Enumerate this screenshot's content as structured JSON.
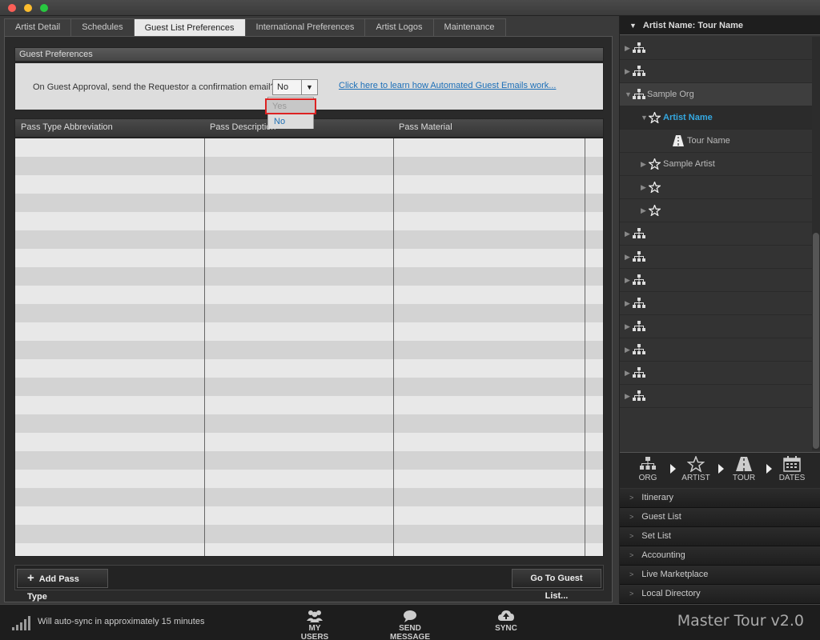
{
  "window": {
    "title": ""
  },
  "tabs": [
    {
      "label": "Artist Detail"
    },
    {
      "label": "Schedules"
    },
    {
      "label": "Guest List Preferences"
    },
    {
      "label": "International Preferences"
    },
    {
      "label": "Artist Logos"
    },
    {
      "label": "Maintenance"
    }
  ],
  "active_tab": "Guest List Preferences",
  "guest_prefs": {
    "header": "Guest Preferences",
    "question": "On Guest Approval, send the Requestor a confirmation email?",
    "selected": "No",
    "link": "Click here to learn how Automated Guest Emails work...",
    "options": [
      "Yes",
      "No"
    ]
  },
  "table": {
    "columns": [
      "Pass Type Abbreviation",
      "Pass Description",
      "Pass Material"
    ],
    "rows": []
  },
  "buttons": {
    "add": "Add Pass Type",
    "go": "Go To Guest List..."
  },
  "right_panel": {
    "header": "Artist Name: Tour Name",
    "tree": [
      {
        "type": "org",
        "label": ""
      },
      {
        "type": "org",
        "label": ""
      },
      {
        "type": "org",
        "label": "Sample Org",
        "expanded": true
      },
      {
        "type": "artist",
        "label": "Artist Name",
        "expanded": true,
        "selected": true
      },
      {
        "type": "tour",
        "label": "Tour Name"
      },
      {
        "type": "artist",
        "label": "Sample Artist"
      },
      {
        "type": "artist",
        "label": ""
      },
      {
        "type": "artist",
        "label": ""
      },
      {
        "type": "org",
        "label": ""
      },
      {
        "type": "org",
        "label": ""
      },
      {
        "type": "org",
        "label": ""
      },
      {
        "type": "org",
        "label": ""
      },
      {
        "type": "org",
        "label": ""
      },
      {
        "type": "org",
        "label": ""
      },
      {
        "type": "org",
        "label": ""
      },
      {
        "type": "org",
        "label": ""
      }
    ],
    "nav": {
      "org": "ORG",
      "artist": "ARTIST",
      "tour": "TOUR",
      "dates": "DATES"
    },
    "sections": [
      "Itinerary",
      "Guest List",
      "Set List",
      "Accounting",
      "Live Marketplace",
      "Local Directory"
    ]
  },
  "status": {
    "sync": "Will auto-sync in approximately 15 minutes",
    "my_users": "MY USERS",
    "send_message": "SEND MESSAGE",
    "sync_btn": "SYNC",
    "brand": "Master Tour v2.0"
  },
  "colors": {
    "link": "#1c6fb8",
    "selected_text": "#35a8e0",
    "highlight_border": "#d22222"
  }
}
